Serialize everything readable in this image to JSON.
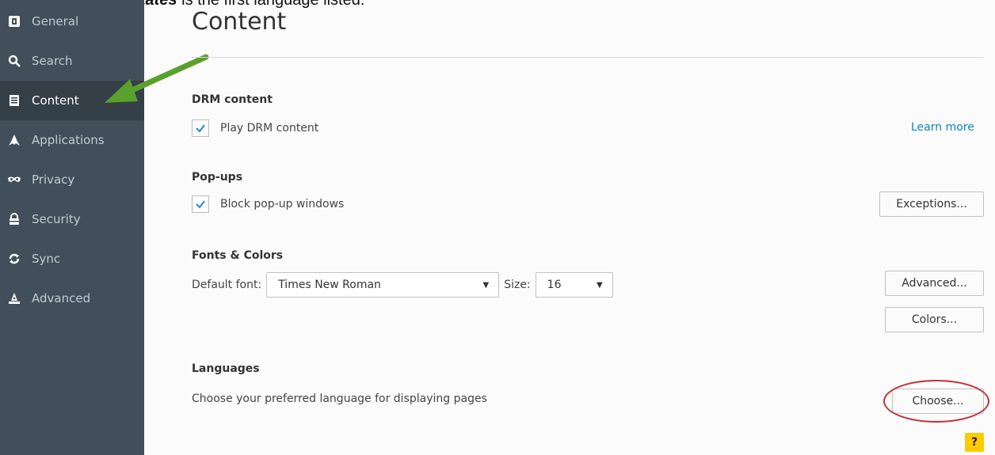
{
  "caption": {
    "bold": "English/United States",
    "rest": " is the first language listed."
  },
  "sidebar": {
    "items": [
      {
        "label": "General",
        "icon": "general-icon"
      },
      {
        "label": "Search",
        "icon": "search-icon"
      },
      {
        "label": "Content",
        "icon": "content-icon",
        "active": true
      },
      {
        "label": "Applications",
        "icon": "applications-icon"
      },
      {
        "label": "Privacy",
        "icon": "privacy-mask-icon"
      },
      {
        "label": "Security",
        "icon": "security-lock-icon"
      },
      {
        "label": "Sync",
        "icon": "sync-icon"
      },
      {
        "label": "Advanced",
        "icon": "advanced-wizard-icon"
      }
    ]
  },
  "page": {
    "title": "Content"
  },
  "drm": {
    "heading": "DRM content",
    "checkbox_label": "Play DRM content",
    "checkbox_checked": true,
    "learn_more": "Learn more"
  },
  "popups": {
    "heading": "Pop-ups",
    "checkbox_label": "Block pop-up windows",
    "checkbox_checked": true,
    "exceptions_button": "Exceptions..."
  },
  "fonts": {
    "heading": "Fonts & Colors",
    "default_font_label": "Default font:",
    "default_font_value": "Times New Roman",
    "size_label": "Size:",
    "size_value": "16",
    "advanced_button": "Advanced...",
    "colors_button": "Colors..."
  },
  "languages": {
    "heading": "Languages",
    "description": "Choose your preferred language for displaying pages",
    "choose_button": "Choose..."
  },
  "help": {
    "label": "?"
  },
  "colors": {
    "sidebar_bg": "#424f5a",
    "sidebar_active": "#343f48",
    "link": "#0a84c8",
    "annotation_arrow": "#5aa02c",
    "annotation_circle": "#c2323c",
    "help_bg": "#ffcb00"
  }
}
